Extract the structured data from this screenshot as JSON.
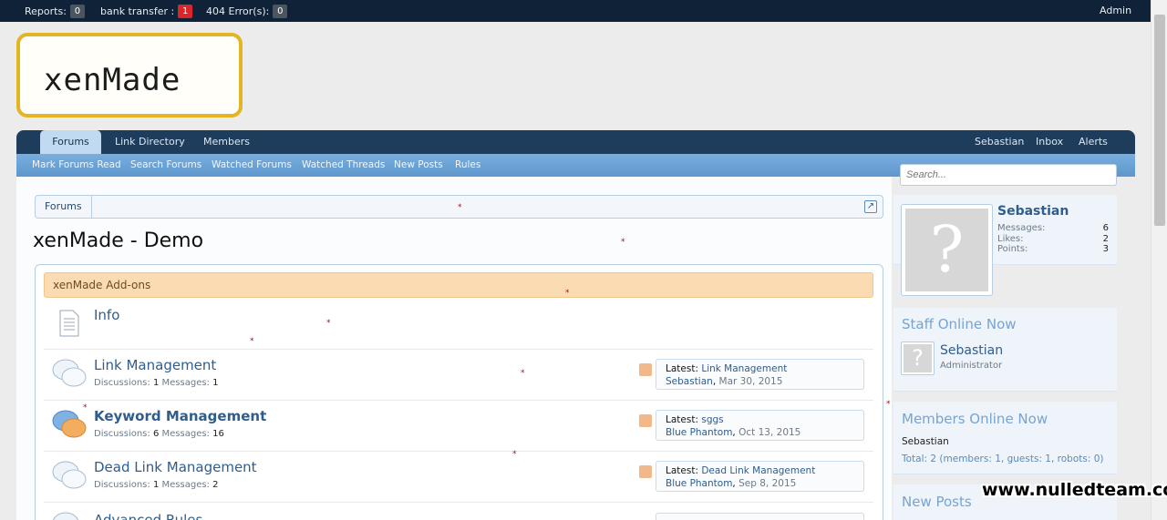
{
  "admin_bar": {
    "reports_label": "Reports:",
    "reports_count": "0",
    "bank_transfer_label": "bank transfer :",
    "bank_transfer_count": "1",
    "errors_label": "404 Error(s):",
    "errors_count": "0",
    "admin_link": "Admin"
  },
  "logo": {
    "text": "xenMade"
  },
  "nav": {
    "tabs": [
      {
        "label": "Forums",
        "active": true
      },
      {
        "label": "Link Directory",
        "active": false
      },
      {
        "label": "Members",
        "active": false
      }
    ],
    "user": "Sebastian",
    "inbox": "Inbox",
    "alerts": "Alerts"
  },
  "subnav": {
    "links": [
      "Mark Forums Read",
      "Search Forums",
      "Watched Forums",
      "Watched Threads",
      "New Posts",
      "Rules"
    ]
  },
  "search": {
    "placeholder": "Search..."
  },
  "breadcrumb": {
    "items": [
      "Forums"
    ]
  },
  "page_title": "xenMade - Demo",
  "category": {
    "title": "xenMade Add-ons"
  },
  "forums": [
    {
      "title": "Info",
      "bold": false
    },
    {
      "title": "Link Management",
      "bold": false,
      "discussions_label": "Discussions:",
      "discussions": "1",
      "messages_label": "Messages:",
      "messages": "1",
      "latest_label": "Latest:",
      "latest_title": "Link Management",
      "latest_user": "Sebastian",
      "latest_date": "Mar 30, 2015"
    },
    {
      "title": "Keyword Management",
      "bold": true,
      "discussions_label": "Discussions:",
      "discussions": "6",
      "messages_label": "Messages:",
      "messages": "16",
      "latest_label": "Latest:",
      "latest_title": "sggs",
      "latest_user": "Blue Phantom",
      "latest_date": "Oct 13, 2015"
    },
    {
      "title": "Dead Link Management",
      "bold": false,
      "discussions_label": "Discussions:",
      "discussions": "1",
      "messages_label": "Messages:",
      "messages": "2",
      "latest_label": "Latest:",
      "latest_title": "Dead Link Management",
      "latest_user": "Blue Phantom",
      "latest_date": "Sep 8, 2015"
    },
    {
      "title": "Advanced Rules"
    }
  ],
  "sidebar": {
    "visitor": {
      "name": "Sebastian",
      "stats": [
        {
          "label": "Messages:",
          "value": "6"
        },
        {
          "label": "Likes:",
          "value": "2"
        },
        {
          "label": "Points:",
          "value": "3"
        }
      ]
    },
    "staff_online": {
      "heading": "Staff Online Now",
      "name": "Sebastian",
      "role": "Administrator"
    },
    "members_online": {
      "heading": "Members Online Now",
      "name": "Sebastian",
      "total": "Total: 2 (members: 1, guests: 1, robots: 0)"
    },
    "new_posts": {
      "heading": "New Posts"
    }
  },
  "watermark": "www.nulledteam.com"
}
